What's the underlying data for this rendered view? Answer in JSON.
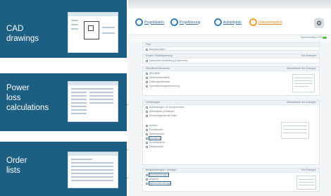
{
  "tiles": [
    {
      "label": "CAD\ndrawings"
    },
    {
      "label": "Power\nloss\ncalculations"
    },
    {
      "label": "Order\nlists"
    }
  ],
  "app": {
    "steps": [
      {
        "label": "Projektdaten"
      },
      {
        "label": "Projektierung"
      },
      {
        "label": "Aufstellplan"
      },
      {
        "label": "Dokumentation"
      }
    ],
    "status_text": "Speicherdatum EPL",
    "panels": {
      "project": {
        "title": "Pfad",
        "right": "",
        "rows": [
          "Benutzerdaten"
        ]
      },
      "export": {
        "title": "Projekt / Aufstellplanung",
        "right": "Nur Anzeigen",
        "rows": [
          "Dateiname Aufstellung (Dokument)"
        ]
      },
      "documents": {
        "title": "Stückliste/Dokumente",
        "right": "Aktualisieren   Nur Anzeigen",
        "rows": [
          "Stückliste",
          "Gewichtsstückliste",
          "Leistungsstückliste",
          "Verlustleistungsberechnung"
        ]
      },
      "drawings": {
        "title": "Zeichnungen",
        "right": "Aktualisieren   Nur Anzeigen",
        "rows": [
          "Aufstellungen mit Komponenten",
          "Aufstellplan (Gehäuse)",
          "Zeichnungssatz als Datei",
          "Ansicht",
          "Frontansicht",
          "Seitenansicht",
          "Draufsicht",
          "Schnittansicht",
          "Detailansicht"
        ]
      },
      "order": {
        "title": "Bestellunterlagen / Anfragen",
        "right": "Nur Anzeigen",
        "rows": [
          "Bestellunterlagen",
          "Angebot",
          "Warenkorb-Anfrage"
        ]
      }
    }
  }
}
